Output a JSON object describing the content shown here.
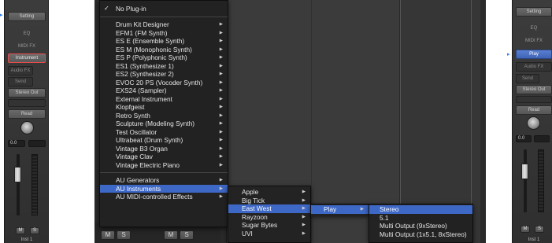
{
  "left_strip": {
    "setting": "Setting",
    "eq": "EQ",
    "midi_fx": "MIDI FX",
    "instrument": "Instrument",
    "audio_fx": "Audio FX",
    "send": "Send",
    "output": "Stereo Out",
    "automation": "Read",
    "volume": "0.0",
    "mute": "M",
    "solo": "S",
    "track_name": "Inst 1"
  },
  "right_strip": {
    "setting": "Setting",
    "eq": "EQ",
    "midi_fx": "MIDI FX",
    "instrument": "Play",
    "audio_fx": "Audio FX",
    "send": "Send",
    "output": "Stereo Out",
    "automation": "Read",
    "volume": "0.0",
    "mute": "M",
    "solo": "S",
    "track_name": "Inst 1"
  },
  "bottom_buttons": [
    "M",
    "S",
    "M",
    "S"
  ],
  "main_menu": {
    "no_plugin": "No Plug-in",
    "checkmark": "✓",
    "instruments": [
      "Drum Kit Designer",
      "EFM1  (FM Synth)",
      "ES E  (Ensemble Synth)",
      "ES M  (Monophonic Synth)",
      "ES P  (Polyphonic Synth)",
      "ES1  (Synthesizer 1)",
      "ES2  (Synthesizer 2)",
      "EVOC 20 PS  (Vocoder Synth)",
      "EXS24  (Sampler)",
      "External Instrument",
      "Klopfgeist",
      "Retro Synth",
      "Sculpture  (Modeling Synth)",
      "Test Oscillator",
      "Ultrabeat  (Drum Synth)",
      "Vintage B3 Organ",
      "Vintage Clav",
      "Vintage Electric Piano"
    ],
    "au_sections": [
      "AU Generators",
      "AU Instruments",
      "AU MIDI-controlled Effects"
    ]
  },
  "vendor_menu": [
    "Apple",
    "Big Tick",
    "East West",
    "Rayzoon",
    "Sugar Bytes",
    "UVI"
  ],
  "product_menu": [
    "Play"
  ],
  "output_menu": [
    "Stereo",
    "5.1",
    "Multi Output (9xStereo)",
    "Multi Output (1x5.1, 8xStereo)"
  ]
}
